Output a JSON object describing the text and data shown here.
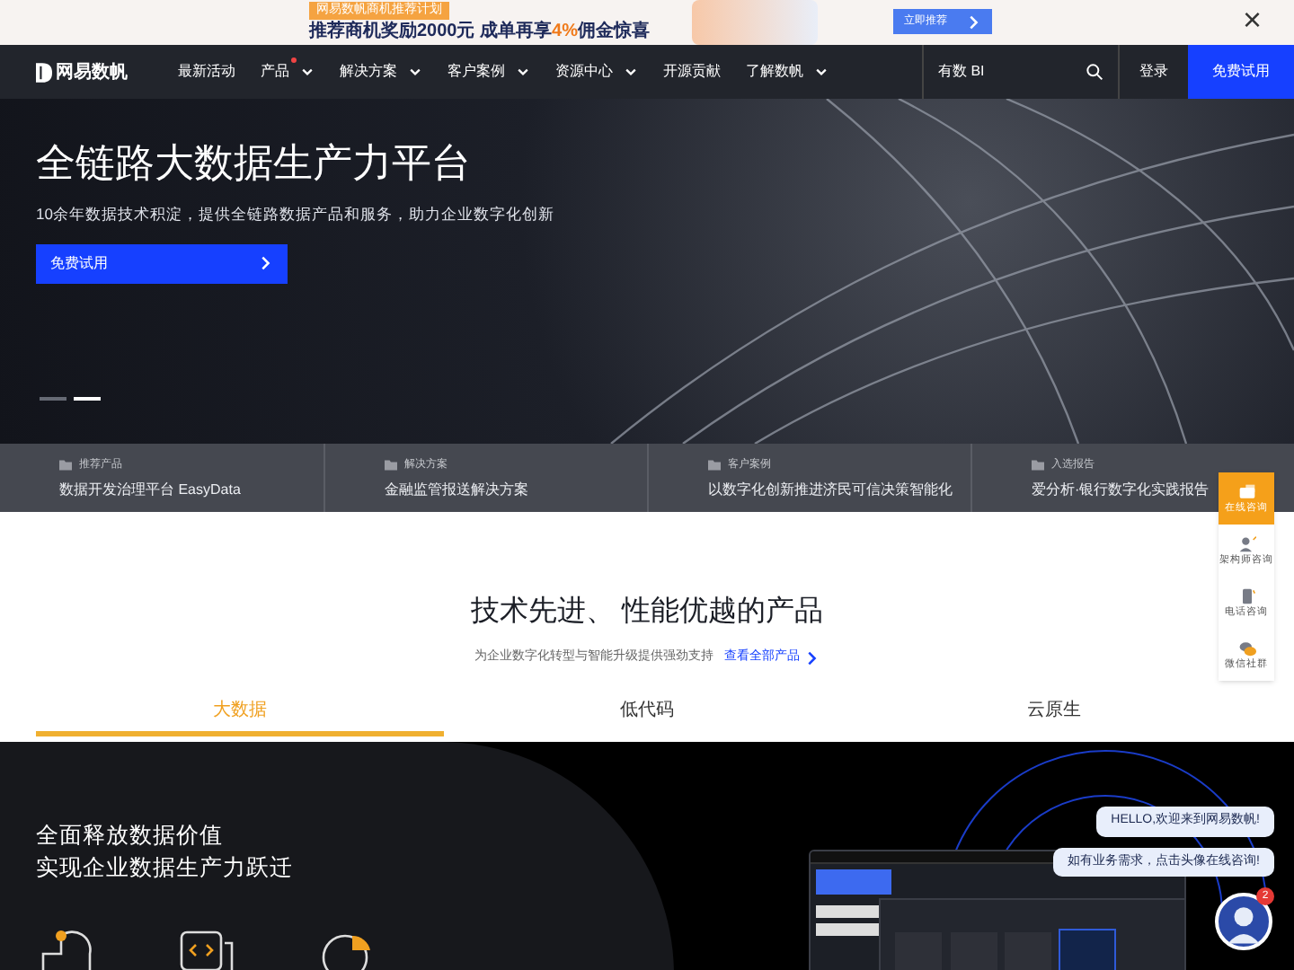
{
  "promo": {
    "badge": "网易数帆商机推荐计划",
    "headline": [
      {
        "text": "推荐商机奖励2000元  成单再享",
        "highlight": false
      },
      {
        "text": "4%",
        "highlight": true
      },
      {
        "text": "佣金惊喜",
        "highlight": false
      }
    ],
    "button": "立即推荐",
    "close": "×"
  },
  "nav": {
    "logo": "网易数帆",
    "items": [
      {
        "label": "最新活动",
        "dropdown": false,
        "dot": false
      },
      {
        "label": "产品",
        "dropdown": true,
        "dot": true
      },
      {
        "label": "解决方案",
        "dropdown": true,
        "dot": false
      },
      {
        "label": "客户案例",
        "dropdown": true,
        "dot": false
      },
      {
        "label": "资源中心",
        "dropdown": true,
        "dot": false
      },
      {
        "label": "开源贡献",
        "dropdown": false,
        "dot": false
      },
      {
        "label": "了解数帆",
        "dropdown": true,
        "dot": false
      }
    ],
    "search": {
      "value": "有数 BI"
    },
    "login": "登录",
    "trial": "免费试用"
  },
  "hero": {
    "title": "全链路大数据生产力平台",
    "subtitle": "10余年数据技术积淀，提供全链路数据产品和服务，助力企业数字化创新",
    "button": "免费试用",
    "slides": [
      {
        "selected": false
      },
      {
        "selected": true
      }
    ]
  },
  "highlights": [
    {
      "category": "推荐产品",
      "title": "数据开发治理平台 EasyData"
    },
    {
      "category": "解决方案",
      "title": "金融监管报送解决方案"
    },
    {
      "category": "客户案例",
      "title": "以数字化创新推进济民可信决策智能化"
    },
    {
      "category": "入选报告",
      "title": "爱分析·银行数字化实践报告"
    }
  ],
  "side_tools": [
    {
      "label": "在线咨询",
      "selected": true
    },
    {
      "label": "架构师咨询",
      "selected": false
    },
    {
      "label": "电话咨询",
      "selected": false
    },
    {
      "label": "微信社群",
      "selected": false
    }
  ],
  "products": {
    "title": "技术先进、 性能优越的产品",
    "subtitle": "为企业数字化转型与智能升级提供强劲支持",
    "link": "查看全部产品",
    "tabs": [
      {
        "label": "大数据",
        "selected": true
      },
      {
        "label": "低代码",
        "selected": false
      },
      {
        "label": "云原生",
        "selected": false
      }
    ]
  },
  "feature": {
    "lines": [
      "全面释放数据价值",
      "实现企业数据生产力跃迁"
    ]
  },
  "chat": {
    "messages": [
      "HELLO,欢迎来到网易数帆!",
      "如有业务需求，点击头像在线咨询!"
    ],
    "unread": "2"
  }
}
